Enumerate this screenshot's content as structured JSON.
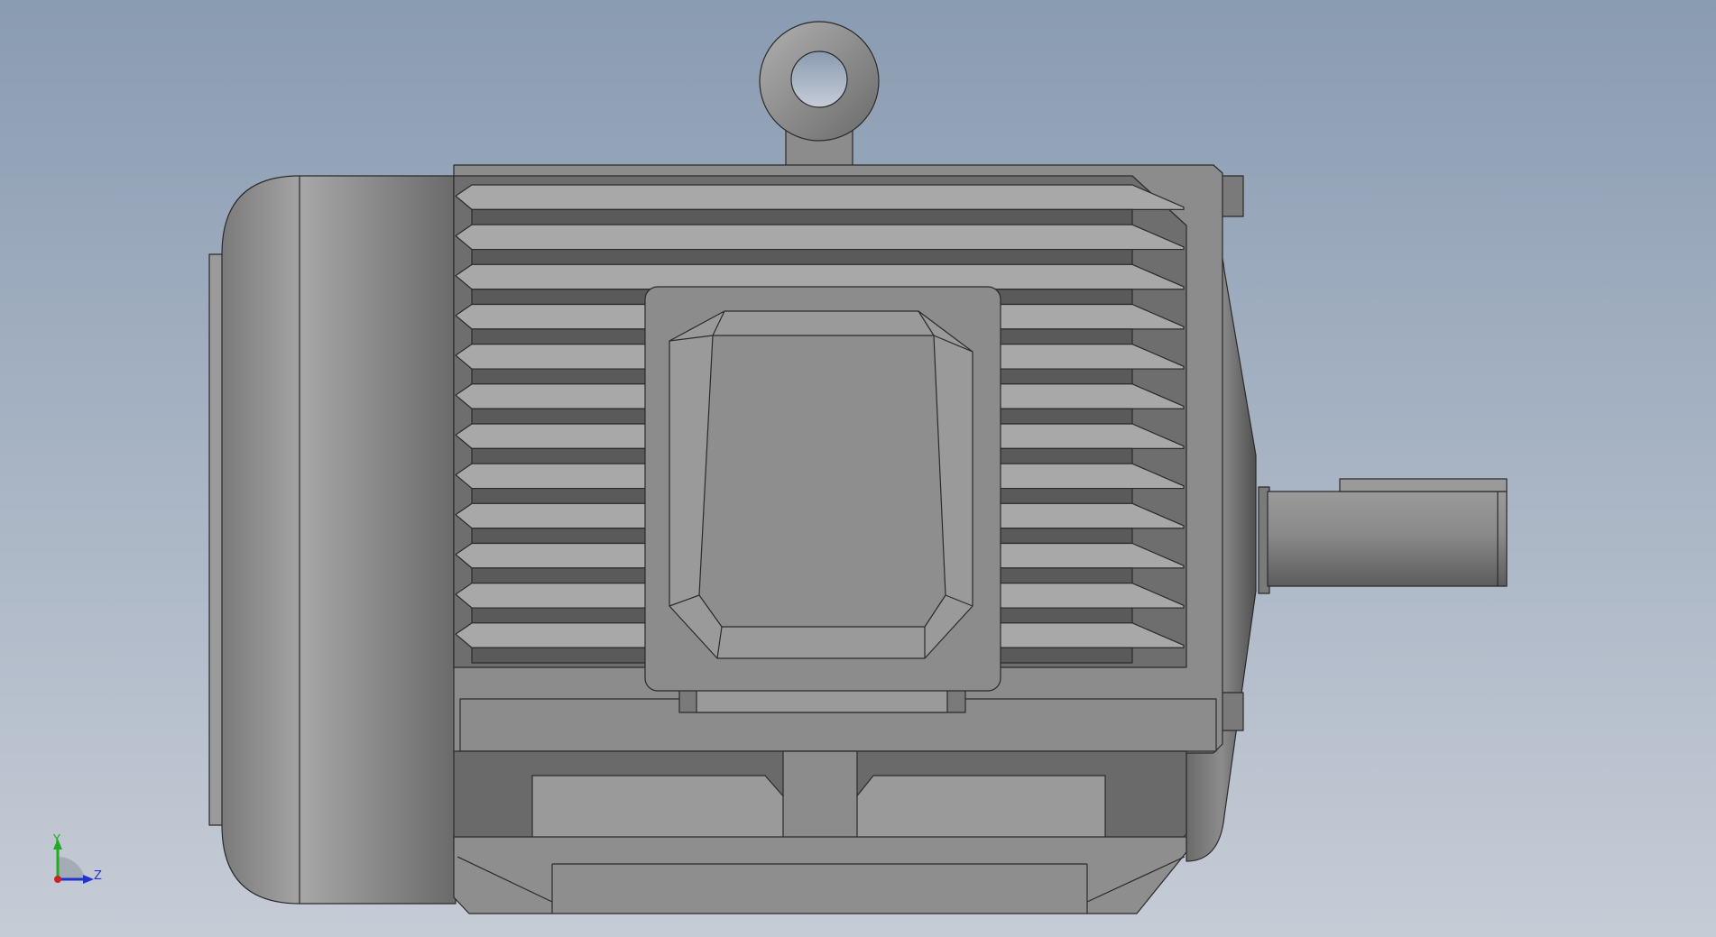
{
  "viewport": {
    "background_top": "#8a9cb2",
    "background_bottom": "#c6ccd6",
    "model_fill": "#8c8c8c",
    "model_dark": "#5a5a5a",
    "model_light": "#a8a8a8",
    "edge_color": "#2a2a2a"
  },
  "model": {
    "subject": "electric-motor",
    "fin_count": 12
  },
  "triad": {
    "y_label": "Y",
    "z_label": "Z",
    "x_color": "#cc2222",
    "y_color": "#22aa22",
    "z_color": "#2233cc"
  }
}
